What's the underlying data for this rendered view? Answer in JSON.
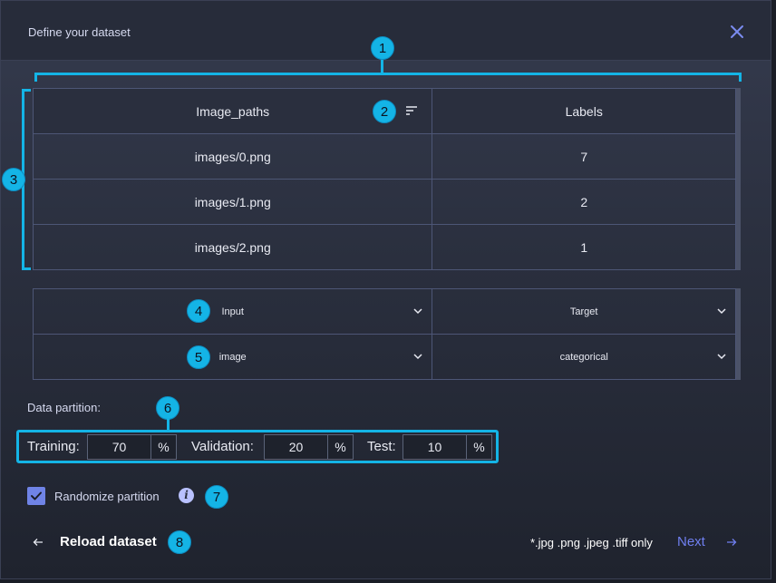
{
  "dialog": {
    "title": "Define your dataset"
  },
  "icons": {
    "close": "close-icon",
    "sort": "sort-icon",
    "chevron": "chevron-down-icon",
    "check": "check-icon",
    "info": "info-icon",
    "back": "arrow-left-icon",
    "next": "arrow-right-icon"
  },
  "colors": {
    "accent": "#14b4e6",
    "link": "#6f7ff0",
    "checkbox": "#6f83e6"
  },
  "table": {
    "headers": [
      "Image_paths",
      "Labels"
    ],
    "rows": [
      [
        "images/0.png",
        "7"
      ],
      [
        "images/1.png",
        "2"
      ],
      [
        "images/2.png",
        "1"
      ]
    ]
  },
  "selectors": {
    "role": [
      "Input",
      "Target"
    ],
    "type": [
      "image",
      "categorical"
    ]
  },
  "partition": {
    "label": "Data partition:",
    "training_label": "Training:",
    "training_value": "70",
    "validation_label": "Validation:",
    "validation_value": "20",
    "test_label": "Test:",
    "test_value": "10",
    "unit": "%"
  },
  "randomize": {
    "label": "Randomize partition",
    "checked": true,
    "info_glyph": "i"
  },
  "footer": {
    "reload_label": "Reload dataset",
    "formats_note": "*.jpg .png .jpeg .tiff only",
    "next_label": "Next"
  },
  "callouts": [
    "1",
    "2",
    "3",
    "4",
    "5",
    "6",
    "7",
    "8"
  ]
}
